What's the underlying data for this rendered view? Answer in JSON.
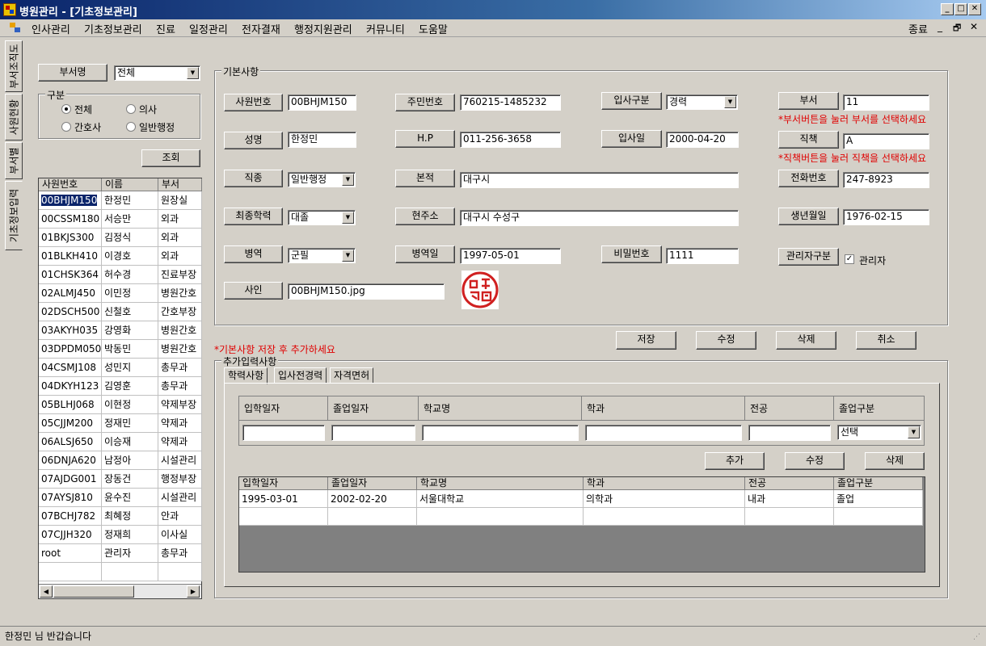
{
  "window": {
    "title": "병원관리 - [기초정보관리]"
  },
  "menu": {
    "items": [
      "인사관리",
      "기초정보관리",
      "진료",
      "일정관리",
      "전자결재",
      "행정지원관리",
      "커뮤니티",
      "도움말"
    ],
    "exit_label": "종료"
  },
  "side_tabs": [
    "부서조직도",
    "사원현황",
    "부서별",
    "기초정보입력"
  ],
  "left": {
    "dept_button": "부서명",
    "dept_select": "전체",
    "group_label": "구분",
    "radios": [
      "전체",
      "의사",
      "간호사",
      "일반행정"
    ],
    "query_button": "조회",
    "columns": [
      "사원번호",
      "이름",
      "부서"
    ],
    "rows": [
      [
        "00BHJM150",
        "한정민",
        "원장실"
      ],
      [
        "00CSSM180",
        "서승만",
        "외과"
      ],
      [
        "01BKJS300",
        "김정식",
        "외과"
      ],
      [
        "01BLKH410",
        "이경호",
        "외과"
      ],
      [
        "01CHSK364",
        "허수경",
        "진료부장"
      ],
      [
        "02ALMJ450",
        "이민정",
        "병원간호"
      ],
      [
        "02DSCH500",
        "신철호",
        "간호부장"
      ],
      [
        "03AKYH035",
        "강영화",
        "병원간호"
      ],
      [
        "03DPDM050",
        "박동민",
        "병원간호"
      ],
      [
        "04CSMJ108",
        "성민지",
        "총무과"
      ],
      [
        "04DKYH123",
        "김영훈",
        "총무과"
      ],
      [
        "05BLHJ068",
        "이현정",
        "약제부장"
      ],
      [
        "05CJJM200",
        "정재민",
        "약제과"
      ],
      [
        "06ALSJ650",
        "이승재",
        "약제과"
      ],
      [
        "06DNJA620",
        "남정아",
        "시설관리"
      ],
      [
        "07AJDG001",
        "장동건",
        "행정부장"
      ],
      [
        "07AYSJ810",
        "윤수진",
        "시설관리"
      ],
      [
        "07BCHJ782",
        "최혜정",
        "안과"
      ],
      [
        "07CJJH320",
        "정재희",
        "이사실"
      ],
      [
        "root",
        "관리자",
        "총무과"
      ]
    ]
  },
  "basic": {
    "group_label": "기본사항",
    "emp_no_label": "사원번호",
    "emp_no": "00BHJM150",
    "name_label": "성명",
    "name": "한정민",
    "job_label": "직종",
    "job": "일반행정",
    "edu_label": "최종학력",
    "edu": "대졸",
    "mil_label": "병역",
    "mil": "군필",
    "sign_label": "사인",
    "sign_file": "00BHJM150.jpg",
    "rrn_label": "주민번호",
    "rrn": "760215-1485232",
    "hp_label": "H.P",
    "hp": "011-256-3658",
    "origin_label": "본적",
    "origin": "대구시",
    "addr_label": "현주소",
    "addr": "대구시 수성구",
    "mil_date_label": "병역일",
    "mil_date": "1997-05-01",
    "hire_type_label": "입사구분",
    "hire_type": "경력",
    "hire_date_label": "입사일",
    "hire_date": "2000-04-20",
    "pw_label": "비밀번호",
    "pw": "1111",
    "dept_label": "부서",
    "dept": "11",
    "dept_hint": "*부서버튼을 눌러 부서를 선택하세요",
    "pos_label": "직책",
    "pos": "A",
    "pos_hint": "*직책버튼을 눌러 직책을 선택하세요",
    "tel_label": "전화번호",
    "tel": "247-8923",
    "birth_label": "생년월일",
    "birth": "1976-02-15",
    "admin_type_label": "관리자구분",
    "admin_check_label": "관리자",
    "save_label": "저장",
    "edit_label": "수정",
    "delete_label": "삭제",
    "cancel_label": "취소",
    "save_hint": "*기본사항 저장 후 추가하세요"
  },
  "extra": {
    "group_label": "추가입력사항",
    "tabs": [
      "학력사항",
      "입사전경력",
      "자격면허"
    ],
    "input_headers": [
      "입학일자",
      "졸업일자",
      "학교명",
      "학과",
      "전공",
      "졸업구분"
    ],
    "grad_select": "선택",
    "add_label": "추가",
    "edit_label": "수정",
    "delete_label": "삭제",
    "columns": [
      "입학일자",
      "졸업일자",
      "학교명",
      "학과",
      "전공",
      "졸업구분"
    ],
    "rows": [
      [
        "1995-03-01",
        "2002-02-20",
        "서울대학교",
        "의학과",
        "내과",
        "졸업"
      ]
    ]
  },
  "status": {
    "text": "한정민 님 반갑습니다"
  }
}
